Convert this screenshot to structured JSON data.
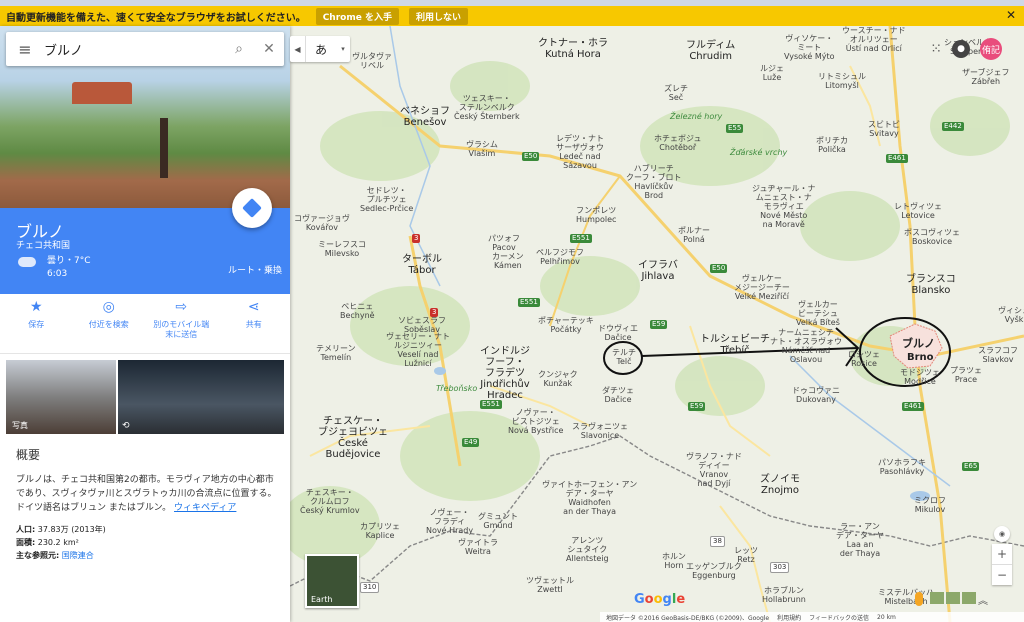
{
  "infobar": {
    "message": "自動更新機能を備えた、速くて安全なブラウザをお試しください。",
    "get_chrome": "Chrome を入手",
    "dismiss": "利用しない",
    "close": "✕"
  },
  "search": {
    "value": "ブルノ",
    "menu_icon": "≡",
    "search_icon": "⌕",
    "clear_icon": "✕"
  },
  "place": {
    "name": "ブルノ",
    "country": "チェコ共和国",
    "weather": "曇り・7°C",
    "time": "6:03",
    "route_label": "ルート・乗換"
  },
  "actions": [
    {
      "icon": "★",
      "label": "保存"
    },
    {
      "icon": "◎",
      "label": "付近を検索"
    },
    {
      "icon": "⇨",
      "label": "別のモバイル端\n末に送信"
    },
    {
      "icon": "⋖",
      "label": "共有"
    }
  ],
  "photos": {
    "photo_label": "写真",
    "streetview_icon": "⟲"
  },
  "overview": {
    "heading": "概要",
    "text": "ブルノは、チェコ共和国第2の都市。モラヴィア地方の中心都市であり、スヴィタヴァ川とスヴラトゥカ川の合流点に位置する。ドイツ語名はブリュン またはブルン。",
    "link": "ウィキペディア",
    "population_label": "人口:",
    "population_value": " 37.83万 (2013年)",
    "area_label": "面積:",
    "area_value": " 230.2 km²",
    "ref_label": "主な参照元:",
    "ref_value": " 国際連合"
  },
  "map_top": {
    "lang": "あ",
    "left_arrow": "◀",
    "dropdown": "▾",
    "apps_icon": "⁙",
    "bell": "●",
    "avatar": "侑記"
  },
  "map_labels": [
    {
      "t": "ヴルタヴァ\nリベル",
      "k": ""
    },
    {
      "t": "クトナー・ホラ\nKutná Hora",
      "k": "big"
    },
    {
      "t": "フルディム\nChrudim",
      "k": "big"
    },
    {
      "t": "ヴィソケー・\nミート\nVysoké Mýto",
      "k": ""
    },
    {
      "t": "ウースチー・ナド\nオルリツェー\nÚstí nad Orlicí",
      "k": ""
    },
    {
      "t": "シュンベルク\nŠumperk",
      "k": ""
    },
    {
      "t": "ザーブジェフ\nZábřeh",
      "k": ""
    },
    {
      "t": "ルジェ\nLuže",
      "k": ""
    },
    {
      "t": "リトミシュル\nLitomyšl",
      "k": ""
    },
    {
      "t": "ズレチ\nSeč",
      "k": ""
    },
    {
      "t": "ベネショフ\nBenešov",
      "k": "big"
    },
    {
      "t": "ツェスキー・\nステルンベルク\nČeský Šternberk",
      "k": ""
    },
    {
      "t": "Železné hory",
      "k": "green"
    },
    {
      "t": "スビトビ\nSvitavy",
      "k": ""
    },
    {
      "t": "ホチェボジュ\nChotěboř",
      "k": ""
    },
    {
      "t": "Žďárské vrchy",
      "k": "green"
    },
    {
      "t": "ポリチカ\nPolička",
      "k": ""
    },
    {
      "t": "レデツ・ナト\nサーザヴォウ\nLedeč nad\nSázavou",
      "k": ""
    },
    {
      "t": "ヴラシム\nVlašim",
      "k": ""
    },
    {
      "t": "ハブリーチ\nクーフ・ブロト\nHavlíčkův\nBrod",
      "k": ""
    },
    {
      "t": "ジュヂャール・ナ\nムニェスト・ナ\nモラヴィエ\nNové Město\nna Moravě",
      "k": ""
    },
    {
      "t": "レトヴィツェ\nLetovice",
      "k": ""
    },
    {
      "t": "ボスコヴィツェ\nBoskovice",
      "k": ""
    },
    {
      "t": "セドレツ・\nプルチツェ\nSedlec-Prčice",
      "k": ""
    },
    {
      "t": "フンポレツ\nHumpolec",
      "k": ""
    },
    {
      "t": "ポルナー\nPolná",
      "k": ""
    },
    {
      "t": "コヴァージョヴ\nKovářov",
      "k": ""
    },
    {
      "t": "ミーレフスコ\nMilevsko",
      "k": ""
    },
    {
      "t": "パツォフ\nPacov",
      "k": ""
    },
    {
      "t": "カーメン\nKámen",
      "k": ""
    },
    {
      "t": "ペルフジモフ\nPelhřimov",
      "k": ""
    },
    {
      "t": "ターボル\nTábor",
      "k": "big"
    },
    {
      "t": "イフラバ\nJihlava",
      "k": "big"
    },
    {
      "t": "ブランスコ\nBlansko",
      "k": "big"
    },
    {
      "t": "ヴェルケー\nメジージーチー\nVelké Meziříčí",
      "k": ""
    },
    {
      "t": "ヴェルカー\nビーテシュ\nVelká Bíteš",
      "k": ""
    },
    {
      "t": "ベヒニェ\nBechyně",
      "k": ""
    },
    {
      "t": "ソビェスラフ\nSoběslav",
      "k": ""
    },
    {
      "t": "ヴェセリー・ナト\nルジニツィー\nVeselí nad\nLužnicí",
      "k": ""
    },
    {
      "t": "ポチャーテッキ\nPočátky",
      "k": ""
    },
    {
      "t": "ドウヴィエ\nDačice",
      "k": ""
    },
    {
      "t": "トルシェビーチ\nTřebíč",
      "k": "big"
    },
    {
      "t": "ナームニェシチ\nナト・オスラヴォウ\nNáměšť nad\nOslavou",
      "k": ""
    },
    {
      "t": "テメリーン\nTemelín",
      "k": ""
    },
    {
      "t": "インドルジ\nフーフ・\nフラデツ\nJindřichův\nHradec",
      "k": "big"
    },
    {
      "t": "クンジャク\nKunžak",
      "k": ""
    },
    {
      "t": "Třeboňsko",
      "k": "green"
    },
    {
      "t": "ロシツェ\nRosice",
      "k": ""
    },
    {
      "t": "ドゥコヴァニ\nDukovany",
      "k": ""
    },
    {
      "t": "スラフコフ\nSlavkov",
      "k": ""
    },
    {
      "t": "プラツェ\nPrace",
      "k": ""
    },
    {
      "t": "ヴィシュ\nVyšk",
      "k": ""
    },
    {
      "t": "チェスケー・\nブジェヨビツェ\nČeské\nBudějovice",
      "k": "big"
    },
    {
      "t": "ノヴァー・\nビストジツェ\nNová Bystřice",
      "k": ""
    },
    {
      "t": "スラヴォニツェ\nSlavonice",
      "k": ""
    },
    {
      "t": "ダチツェ\nDačice",
      "k": ""
    },
    {
      "t": "ヴラノフ・ナド\nディイー\nVranov\nnad Dyjí",
      "k": ""
    },
    {
      "t": "ズノイモ\nZnojmo",
      "k": "big"
    },
    {
      "t": "パソホラフキ\nPasohlávky",
      "k": ""
    },
    {
      "t": "ミクロフ\nMikulov",
      "k": ""
    },
    {
      "t": "チェスキー・\nクルムロフ\nČeský Krumlov",
      "k": ""
    },
    {
      "t": "カプリツェ\nKaplice",
      "k": ""
    },
    {
      "t": "ノヴェー・\nフラディ\nNové Hrady",
      "k": ""
    },
    {
      "t": "グミュント\nGmünd",
      "k": ""
    },
    {
      "t": "ヴァイトホーフェン・アン\nデア・ターヤ\nWaidhofen\nan der Thaya",
      "k": ""
    },
    {
      "t": "ラー・アン\nデア・ターヤ\nLaa an\nder Thaya",
      "k": ""
    },
    {
      "t": "ヴァイトラ\nWeitra",
      "k": ""
    },
    {
      "t": "アレンツ\nシュタイク\nAllentsteig",
      "k": ""
    },
    {
      "t": "ホルン\nHorn",
      "k": ""
    },
    {
      "t": "エッゲンブルク\nEggenburg",
      "k": ""
    },
    {
      "t": "レッツ\nRetz",
      "k": ""
    },
    {
      "t": "ツヴェットル\nZwettl",
      "k": ""
    },
    {
      "t": "ホラブルン\nHollabrunn",
      "k": ""
    },
    {
      "t": "ミステルバッハ\nMistelbach",
      "k": ""
    },
    {
      "t": "テルチ\nTelč",
      "k": ""
    }
  ],
  "target": {
    "name": "ブルノ",
    "latin": "Brno",
    "sub": "モドジツェ\nModřice"
  },
  "roads": [
    {
      "t": "E50"
    },
    {
      "t": "E551"
    },
    {
      "t": "E59"
    },
    {
      "t": "E49"
    },
    {
      "t": "E461"
    },
    {
      "t": "E442"
    },
    {
      "t": "E65"
    },
    {
      "t": "E55"
    },
    {
      "t": "3"
    },
    {
      "t": "38"
    },
    {
      "t": "303"
    },
    {
      "t": "310"
    }
  ],
  "earth_label": "Earth",
  "google": [
    "G",
    "o",
    "o",
    "g",
    "l",
    "e"
  ],
  "footer": [
    "地図データ ©2016 GeoBasis-DE/BKG (©2009)、Google",
    "利用規約",
    "フィードバックの送信",
    "20 km"
  ],
  "zoom": {
    "in": "+",
    "out": "−",
    "compass": "◉"
  }
}
